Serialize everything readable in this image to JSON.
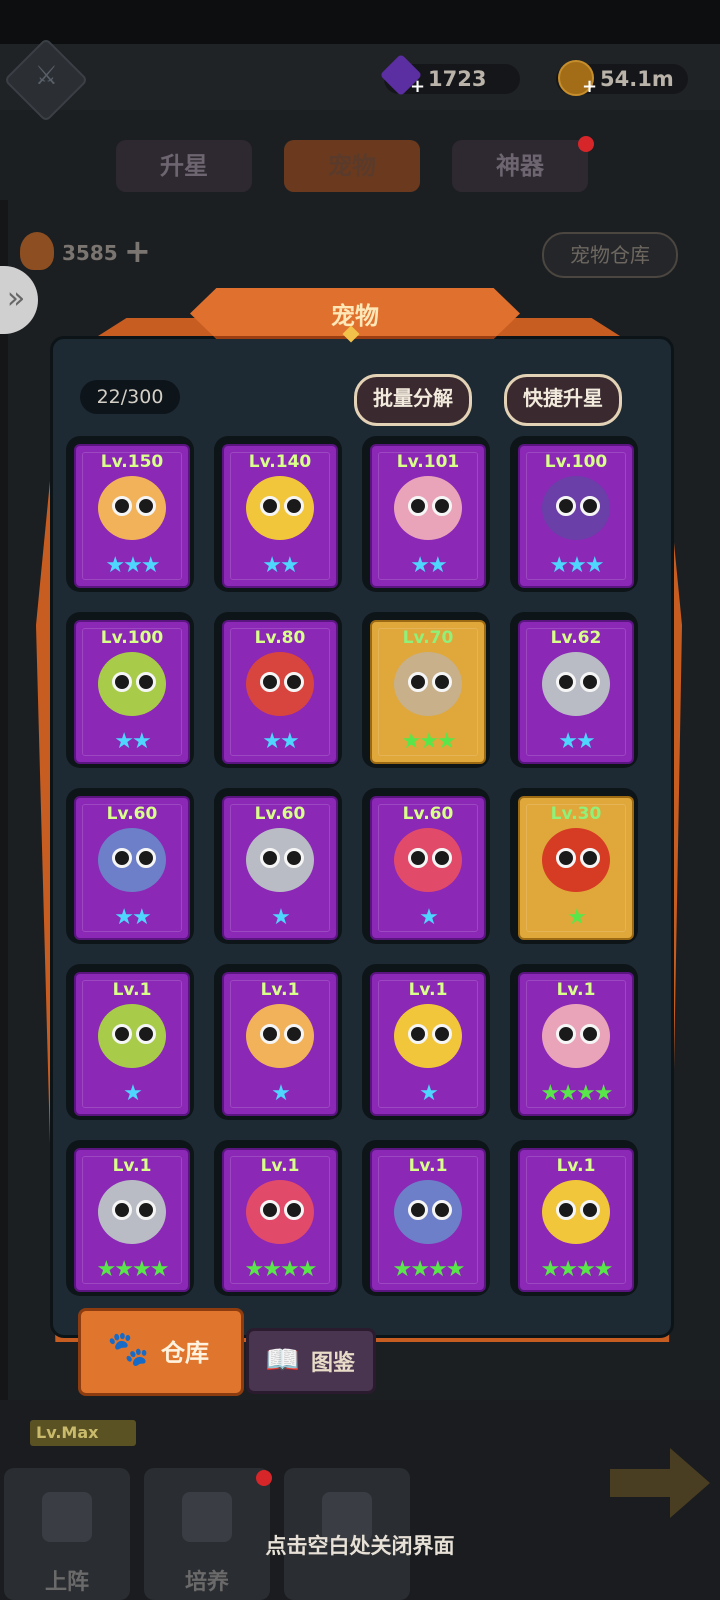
{
  "currency": {
    "gems": "1723",
    "gold": "54.1m"
  },
  "tabs": [
    {
      "label": "升星"
    },
    {
      "label": "宠物"
    },
    {
      "label": "神器"
    }
  ],
  "resource": {
    "value": "3585"
  },
  "warehouse_button": "宠物仓库",
  "panel": {
    "title": "宠物",
    "counter": "22/300",
    "batch_decompose": "批量分解",
    "quick_star": "快捷升星"
  },
  "pets": [
    {
      "level": "Lv.150",
      "stars": "★★★",
      "star_color": "cyan",
      "frame": "purple",
      "color": "#f2b25a"
    },
    {
      "level": "Lv.140",
      "stars": "★★",
      "star_color": "cyan",
      "frame": "purple",
      "color": "#f1c63a"
    },
    {
      "level": "Lv.101",
      "stars": "★★",
      "star_color": "cyan",
      "frame": "purple",
      "color": "#e9a4b9"
    },
    {
      "level": "Lv.100",
      "stars": "★★★",
      "star_color": "cyan",
      "frame": "purple",
      "color": "#6a3fa8"
    },
    {
      "level": "Lv.100",
      "stars": "★★",
      "star_color": "cyan",
      "frame": "purple",
      "color": "#a8cc4a"
    },
    {
      "level": "Lv.80",
      "stars": "★★",
      "star_color": "cyan",
      "frame": "purple",
      "color": "#d8453e"
    },
    {
      "level": "Lv.70",
      "stars": "★★★",
      "star_color": "green",
      "frame": "gold",
      "color": "#c7b08a"
    },
    {
      "level": "Lv.62",
      "stars": "★★",
      "star_color": "cyan",
      "frame": "purple",
      "color": "#b9bcc4"
    },
    {
      "level": "Lv.60",
      "stars": "★★",
      "star_color": "cyan",
      "frame": "purple",
      "color": "#6d7fc8"
    },
    {
      "level": "Lv.60",
      "stars": "★",
      "star_color": "cyan",
      "frame": "purple",
      "color": "#b9bcc4"
    },
    {
      "level": "Lv.60",
      "stars": "★",
      "star_color": "cyan",
      "frame": "purple",
      "color": "#e24a6a"
    },
    {
      "level": "Lv.30",
      "stars": "★",
      "star_color": "green",
      "frame": "gold",
      "color": "#d63b24"
    },
    {
      "level": "Lv.1",
      "stars": "★",
      "star_color": "cyan",
      "frame": "purple",
      "color": "#a8cc4a"
    },
    {
      "level": "Lv.1",
      "stars": "★",
      "star_color": "cyan",
      "frame": "purple",
      "color": "#f2b25a"
    },
    {
      "level": "Lv.1",
      "stars": "★",
      "star_color": "cyan",
      "frame": "purple",
      "color": "#f1c63a"
    },
    {
      "level": "Lv.1",
      "stars": "★★★★",
      "star_color": "green",
      "frame": "purple",
      "color": "#e9a4b9"
    },
    {
      "level": "Lv.1",
      "stars": "★★★★",
      "star_color": "green",
      "frame": "purple",
      "color": "#b9bcc4"
    },
    {
      "level": "Lv.1",
      "stars": "★★★★",
      "star_color": "green",
      "frame": "purple",
      "color": "#e24a6a"
    },
    {
      "level": "Lv.1",
      "stars": "★★★★",
      "star_color": "green",
      "frame": "purple",
      "color": "#6d7fc8"
    },
    {
      "level": "Lv.1",
      "stars": "★★★★",
      "star_color": "green",
      "frame": "purple",
      "color": "#f1c63a"
    }
  ],
  "bottom_tabs": {
    "warehouse": "仓库",
    "codex": "图鉴"
  },
  "lv_max": "Lv.Max",
  "nav": {
    "deploy": "上阵",
    "train": "培养"
  },
  "close_hint": "点击空白处关闭界面"
}
